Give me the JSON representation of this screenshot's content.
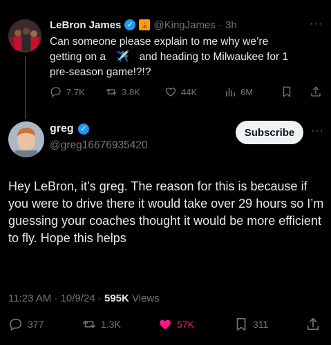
{
  "tweet1": {
    "author_name": "LeBron James",
    "handle": "@KingJames",
    "time": "· 3h",
    "text_line1": "Can someone please explain to me why we’re",
    "text_line2a": "getting on a",
    "text_line2b": "and heading to Milwaukee for 1",
    "text_line3": "pre-season game!?!?",
    "emoji": "✈️",
    "flag": "🗼",
    "actions": {
      "replies": "7.7K",
      "retweets": "3.8K",
      "likes": "44K",
      "views": "6M"
    },
    "more": "···"
  },
  "tweet2": {
    "author_name": "greg",
    "handle": "@greg16676935420",
    "subscribe_label": "Subscribe",
    "more": "···",
    "body": "Hey LeBron, it’s greg. The reason for this is because if you were to drive there it would take over 29 hours so I’m guessing your coaches thought it would be more efficient to fly. Hope this helps",
    "meta_time": "11:23 AM · 10/9/24 ·",
    "meta_views_count": "595K",
    "meta_views_label": "Views",
    "actions": {
      "replies": "377",
      "retweets": "1.3K",
      "likes": "57K",
      "bookmarks": "311"
    }
  },
  "colors": {
    "accent": "#1d9bf0",
    "like": "#f91880",
    "muted": "#71767b",
    "text": "#e7e9ea"
  }
}
